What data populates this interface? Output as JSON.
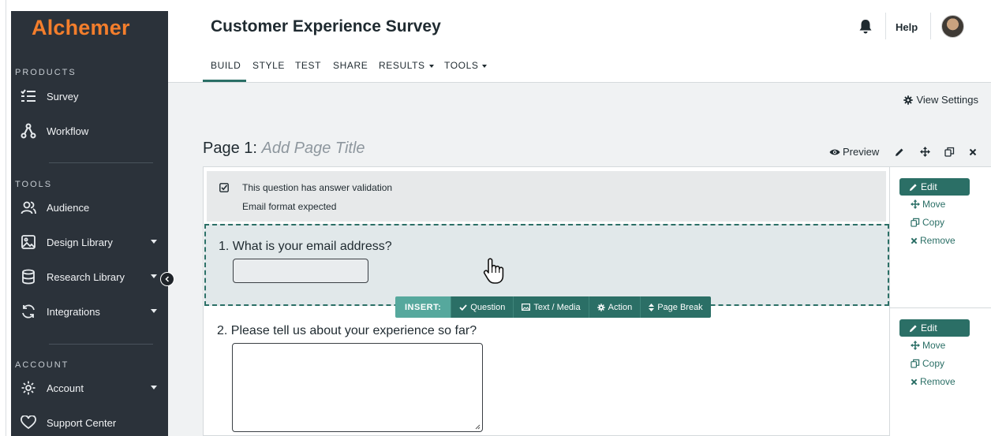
{
  "brand": {
    "logo_text": "Alchemer",
    "logo_color": "#f47e2c",
    "sidebar_bg": "#2b323a",
    "accent": "#2b6f66"
  },
  "sidebar": {
    "products_title": "PRODUCTS",
    "tools_title": "TOOLS",
    "account_title": "ACCOUNT",
    "products": [
      {
        "label": "Survey",
        "icon": "survey-list-icon"
      },
      {
        "label": "Workflow",
        "icon": "workflow-icon"
      }
    ],
    "tools": [
      {
        "label": "Audience",
        "icon": "audience-icon",
        "has_caret": false
      },
      {
        "label": "Design Library",
        "icon": "image-icon",
        "has_caret": true
      },
      {
        "label": "Research Library",
        "icon": "database-icon",
        "has_caret": true
      },
      {
        "label": "Integrations",
        "icon": "sync-icon",
        "has_caret": true
      }
    ],
    "account": [
      {
        "label": "Account",
        "icon": "gear-icon",
        "has_caret": true
      },
      {
        "label": "Support Center",
        "icon": "heart-icon",
        "has_caret": false
      }
    ]
  },
  "header": {
    "title": "Customer Experience Survey",
    "help_label": "Help"
  },
  "tabs": [
    {
      "label": "BUILD",
      "active": true,
      "caret": false
    },
    {
      "label": "STYLE",
      "active": false,
      "caret": false
    },
    {
      "label": "TEST",
      "active": false,
      "caret": false
    },
    {
      "label": "SHARE",
      "active": false,
      "caret": false
    },
    {
      "label": "RESULTS",
      "active": false,
      "caret": true
    },
    {
      "label": "TOOLS",
      "active": false,
      "caret": true
    }
  ],
  "content": {
    "view_settings_label": "View Settings",
    "page_prefix": "Page 1:",
    "page_title_placeholder": "Add Page Title",
    "preview_label": "Preview"
  },
  "validation": {
    "line1": "This question has answer validation",
    "line2": "Email format expected"
  },
  "questions": [
    {
      "text": "1. What is your email address?"
    },
    {
      "text": "2. Please tell us about your experience so far?"
    }
  ],
  "insert_bar": {
    "label": "INSERT:",
    "question": "Question",
    "text_media": "Text / Media",
    "action": "Action",
    "page_break": "Page Break"
  },
  "actions": {
    "edit": "Edit",
    "move": "Move",
    "copy": "Copy",
    "remove": "Remove"
  }
}
